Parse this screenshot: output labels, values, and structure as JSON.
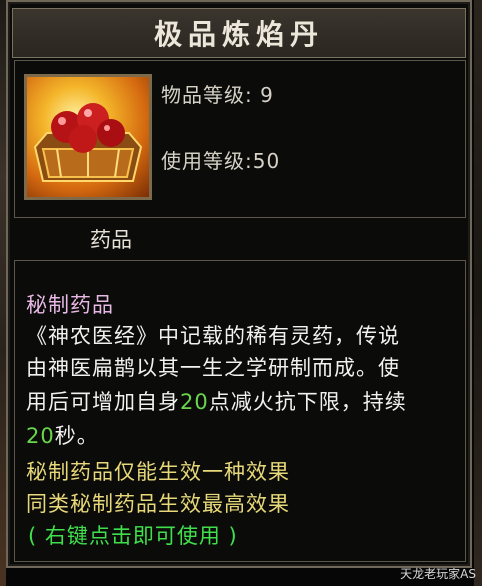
{
  "item": {
    "name": "极品炼焰丹",
    "level_label": "物品等级:",
    "level_value": "9",
    "use_level_label": "使用等级:",
    "use_level_value": "50",
    "category": "药品",
    "icon": "red-pill-crate-icon"
  },
  "description": {
    "subtitle": "秘制药品",
    "line1": "《神农医经》中记载的稀有灵药，传说",
    "line2": "由神医扁鹊以其一生之学研制而成。使",
    "line3_pre": "用后可增加自身",
    "line3_num": "20",
    "line3_post": "点减火抗下限，持续",
    "line4_num": "20",
    "line4_post": "秒。",
    "note1": "秘制药品仅能生效一种效果",
    "note2": "同类秘制药品生效最高效果",
    "usage_hint": "( 右键点击即可使用 )"
  },
  "watermark": "天龙老玩家AS",
  "colors": {
    "subtitle": "#e7b9e4",
    "description": "#f1f1f1",
    "number": "#69d74c",
    "note": "#e7d879",
    "usage": "#3fe04c"
  }
}
